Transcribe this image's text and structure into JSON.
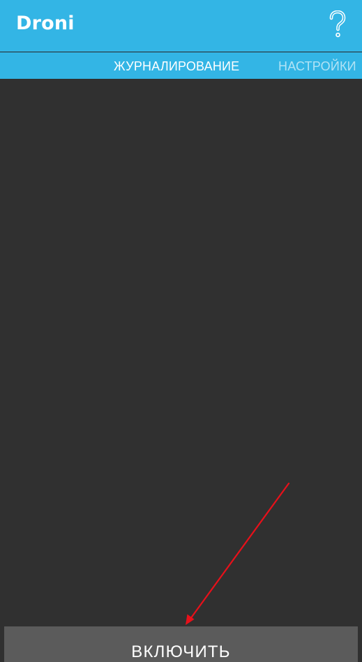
{
  "appbar": {
    "title": "Droni",
    "help_label": "?"
  },
  "tabs": [
    {
      "label": "ЖУРНАЛИРОВАНИЕ",
      "selected": true
    },
    {
      "label": "НАСТРОЙКИ",
      "selected": false
    }
  ],
  "footer": {
    "enable_label": "ВКЛЮЧИТЬ"
  },
  "colors": {
    "accent": "#33b5e5",
    "background": "#303030",
    "button": "#5b5b5b",
    "annotation": "#e8101a"
  }
}
